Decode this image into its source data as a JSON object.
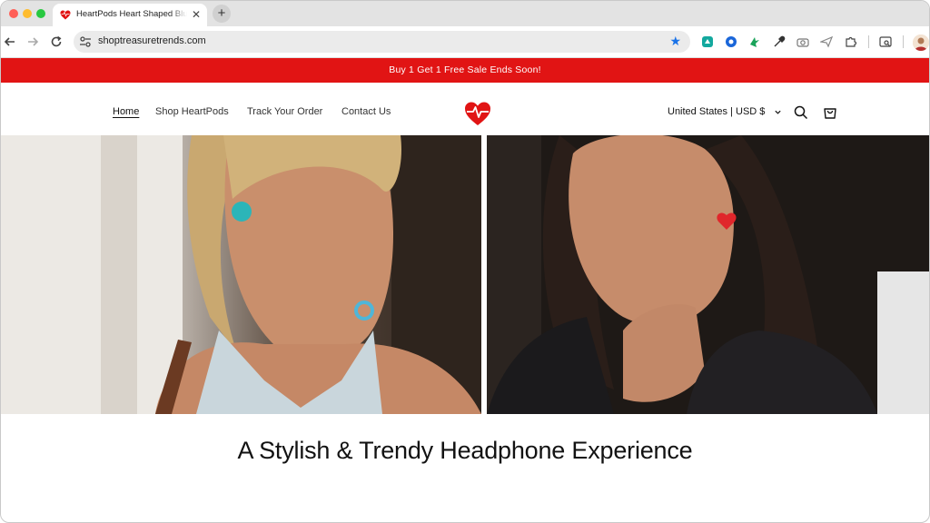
{
  "browser": {
    "tab_title": "HeartPods Heart Shaped Blue",
    "url": "shoptreasuretrends.com"
  },
  "announcement": "Buy 1 Get 1 Free Sale Ends Soon!",
  "header": {
    "nav": [
      {
        "label": "Home"
      },
      {
        "label": "Shop HeartPods"
      },
      {
        "label": "Track Your Order"
      },
      {
        "label": "Contact Us"
      }
    ],
    "currency": "United States | USD $"
  },
  "hero": {
    "headline": "A Stylish & Trendy Headphone Experience"
  },
  "colors": {
    "announcement_bg": "#e11414",
    "brand_red": "#e11414",
    "text_dark": "#121212"
  },
  "icons": {
    "logo": "heart-pulse-icon",
    "search": "search-icon",
    "cart": "cart-icon"
  }
}
